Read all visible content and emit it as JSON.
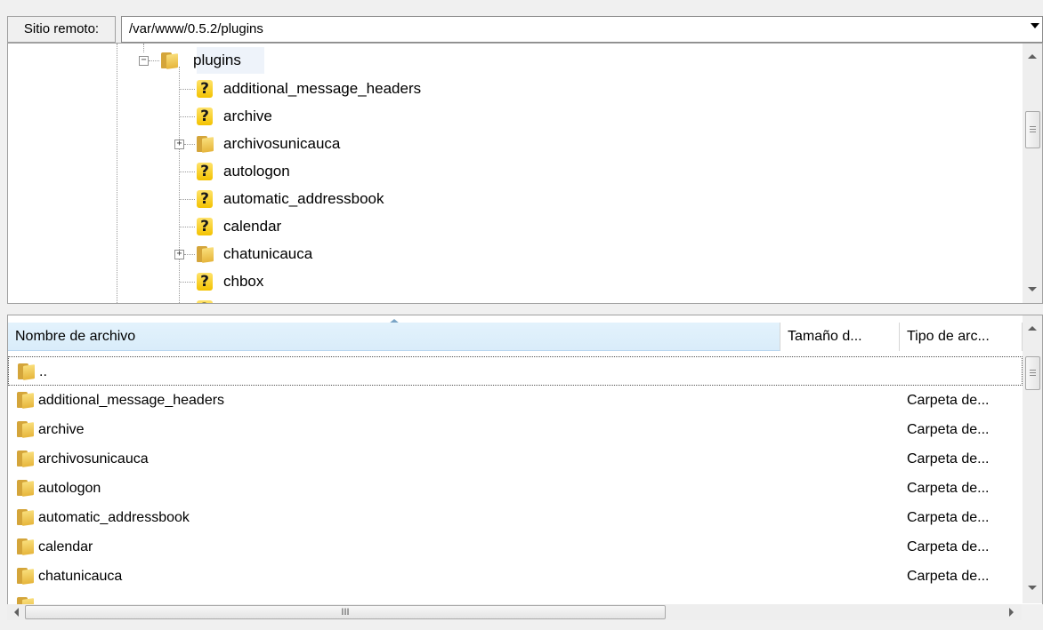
{
  "site_bar": {
    "label": "Sitio remoto:",
    "path": "/var/www/0.5.2/plugins"
  },
  "tree": {
    "root": {
      "label": "plugins",
      "icon": "folder-icon",
      "expanded": true
    },
    "items": [
      {
        "label": "additional_message_headers",
        "icon": "unknown-icon",
        "expandable": false
      },
      {
        "label": "archive",
        "icon": "unknown-icon",
        "expandable": false
      },
      {
        "label": "archivosunicauca",
        "icon": "folder-icon",
        "expandable": true
      },
      {
        "label": "autologon",
        "icon": "unknown-icon",
        "expandable": false
      },
      {
        "label": "automatic_addressbook",
        "icon": "unknown-icon",
        "expandable": false
      },
      {
        "label": "calendar",
        "icon": "unknown-icon",
        "expandable": false
      },
      {
        "label": "chatunicauca",
        "icon": "folder-icon",
        "expandable": true
      },
      {
        "label": "chbox",
        "icon": "unknown-icon",
        "expandable": false
      }
    ]
  },
  "file_list": {
    "columns": [
      {
        "key": "name",
        "label": "Nombre de archivo"
      },
      {
        "key": "size",
        "label": "Tamaño d..."
      },
      {
        "key": "type",
        "label": "Tipo de arc..."
      }
    ],
    "rows": [
      {
        "name": "..",
        "type": ""
      },
      {
        "name": "additional_message_headers",
        "type": "Carpeta de..."
      },
      {
        "name": "archive",
        "type": "Carpeta de..."
      },
      {
        "name": "archivosunicauca",
        "type": "Carpeta de..."
      },
      {
        "name": "autologon",
        "type": "Carpeta de..."
      },
      {
        "name": "automatic_addressbook",
        "type": "Carpeta de..."
      },
      {
        "name": "calendar",
        "type": "Carpeta de..."
      },
      {
        "name": "chatunicauca",
        "type": "Carpeta de..."
      }
    ]
  },
  "scrollbar": {
    "hgrip": "III"
  }
}
